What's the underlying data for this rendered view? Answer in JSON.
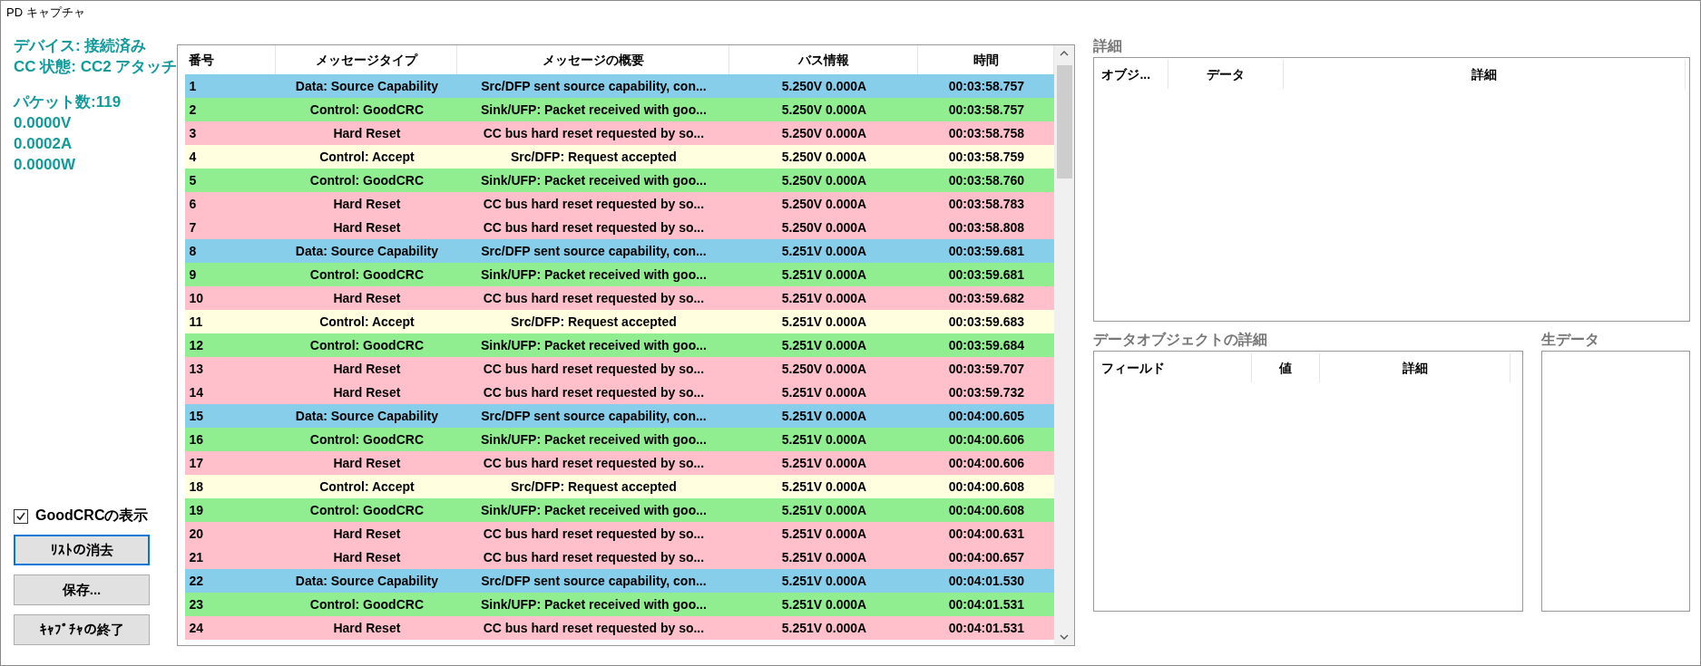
{
  "window": {
    "title": "PD キャプチャ"
  },
  "status": {
    "lines_top": [
      "デバイス: 接続済み",
      "CC 状態: CC2 アタッチ"
    ],
    "lines_bottom": [
      "パケット数:119",
      "0.0000V",
      "0.0002A",
      "0.0000W"
    ]
  },
  "show_goodcrc": {
    "label": "GoodCRCの表示",
    "checked": true
  },
  "buttons": [
    {
      "label": "ﾘｽﾄの消去",
      "focused": true
    },
    {
      "label": "保存...",
      "focused": false
    },
    {
      "label": "ｷｬﾌﾟﾁｬの終了",
      "focused": false
    }
  ],
  "packets": {
    "columns": [
      "番号",
      "メッセージタイプ",
      "メッセージの概要",
      "バス情報",
      "時間"
    ],
    "rows": [
      {
        "cells": [
          "1",
          "Data: Source Capability",
          "Src/DFP sent source capability, con...",
          "5.250V 0.000A",
          "00:03:58.757"
        ],
        "color": "#87ceeb"
      },
      {
        "cells": [
          "2",
          "Control: GoodCRC",
          "Sink/UFP: Packet received with goo...",
          "5.250V 0.000A",
          "00:03:58.757"
        ],
        "color": "#90ee90"
      },
      {
        "cells": [
          "3",
          "Hard Reset",
          "CC bus hard reset requested by so...",
          "5.250V 0.000A",
          "00:03:58.758"
        ],
        "color": "#ffc0cb"
      },
      {
        "cells": [
          "4",
          "Control: Accept",
          "Src/DFP: Request accepted",
          "5.250V 0.000A",
          "00:03:58.759"
        ],
        "color": "#ffffe0"
      },
      {
        "cells": [
          "5",
          "Control: GoodCRC",
          "Sink/UFP: Packet received with goo...",
          "5.250V 0.000A",
          "00:03:58.760"
        ],
        "color": "#90ee90"
      },
      {
        "cells": [
          "6",
          "Hard Reset",
          "CC bus hard reset requested by so...",
          "5.250V 0.000A",
          "00:03:58.783"
        ],
        "color": "#ffc0cb"
      },
      {
        "cells": [
          "7",
          "Hard Reset",
          "CC bus hard reset requested by so...",
          "5.250V 0.000A",
          "00:03:58.808"
        ],
        "color": "#ffc0cb"
      },
      {
        "cells": [
          "8",
          "Data: Source Capability",
          "Src/DFP sent source capability, con...",
          "5.251V 0.000A",
          "00:03:59.681"
        ],
        "color": "#87ceeb"
      },
      {
        "cells": [
          "9",
          "Control: GoodCRC",
          "Sink/UFP: Packet received with goo...",
          "5.251V 0.000A",
          "00:03:59.681"
        ],
        "color": "#90ee90"
      },
      {
        "cells": [
          "10",
          "Hard Reset",
          "CC bus hard reset requested by so...",
          "5.251V 0.000A",
          "00:03:59.682"
        ],
        "color": "#ffc0cb"
      },
      {
        "cells": [
          "11",
          "Control: Accept",
          "Src/DFP: Request accepted",
          "5.251V 0.000A",
          "00:03:59.683"
        ],
        "color": "#ffffe0"
      },
      {
        "cells": [
          "12",
          "Control: GoodCRC",
          "Sink/UFP: Packet received with goo...",
          "5.251V 0.000A",
          "00:03:59.684"
        ],
        "color": "#90ee90"
      },
      {
        "cells": [
          "13",
          "Hard Reset",
          "CC bus hard reset requested by so...",
          "5.250V 0.000A",
          "00:03:59.707"
        ],
        "color": "#ffc0cb"
      },
      {
        "cells": [
          "14",
          "Hard Reset",
          "CC bus hard reset requested by so...",
          "5.251V 0.000A",
          "00:03:59.732"
        ],
        "color": "#ffc0cb"
      },
      {
        "cells": [
          "15",
          "Data: Source Capability",
          "Src/DFP sent source capability, con...",
          "5.251V 0.000A",
          "00:04:00.605"
        ],
        "color": "#87ceeb"
      },
      {
        "cells": [
          "16",
          "Control: GoodCRC",
          "Sink/UFP: Packet received with goo...",
          "5.251V 0.000A",
          "00:04:00.606"
        ],
        "color": "#90ee90"
      },
      {
        "cells": [
          "17",
          "Hard Reset",
          "CC bus hard reset requested by so...",
          "5.251V 0.000A",
          "00:04:00.606"
        ],
        "color": "#ffc0cb"
      },
      {
        "cells": [
          "18",
          "Control: Accept",
          "Src/DFP: Request accepted",
          "5.251V 0.000A",
          "00:04:00.608"
        ],
        "color": "#ffffe0"
      },
      {
        "cells": [
          "19",
          "Control: GoodCRC",
          "Sink/UFP: Packet received with goo...",
          "5.251V 0.000A",
          "00:04:00.608"
        ],
        "color": "#90ee90"
      },
      {
        "cells": [
          "20",
          "Hard Reset",
          "CC bus hard reset requested by so...",
          "5.251V 0.000A",
          "00:04:00.631"
        ],
        "color": "#ffc0cb"
      },
      {
        "cells": [
          "21",
          "Hard Reset",
          "CC bus hard reset requested by so...",
          "5.251V 0.000A",
          "00:04:00.657"
        ],
        "color": "#ffc0cb"
      },
      {
        "cells": [
          "22",
          "Data: Source Capability",
          "Src/DFP sent source capability, con...",
          "5.251V 0.000A",
          "00:04:01.530"
        ],
        "color": "#87ceeb"
      },
      {
        "cells": [
          "23",
          "Control: GoodCRC",
          "Sink/UFP: Packet received with goo...",
          "5.251V 0.000A",
          "00:04:01.531"
        ],
        "color": "#90ee90"
      },
      {
        "cells": [
          "24",
          "Hard Reset",
          "CC bus hard reset requested by so...",
          "5.251V 0.000A",
          "00:04:01.531"
        ],
        "color": "#ffc0cb"
      }
    ]
  },
  "details": {
    "title": "詳細",
    "columns": [
      "オブジ...",
      "データ",
      "詳細"
    ]
  },
  "data_object_details": {
    "title": "データオブジェクトの詳細",
    "columns": [
      "フィールド",
      "値",
      "詳細"
    ]
  },
  "raw_data": {
    "title": "生データ"
  }
}
